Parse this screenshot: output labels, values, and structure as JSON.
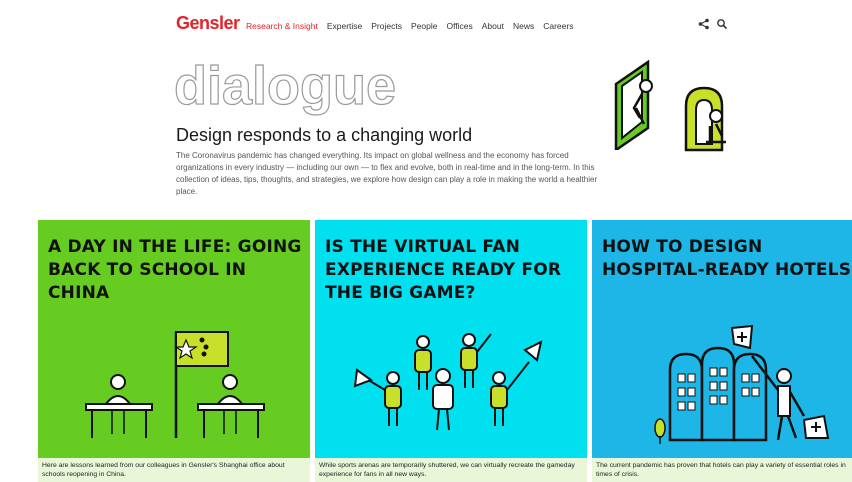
{
  "header": {
    "logo": "Gensler",
    "nav": [
      {
        "label": "Research & Insight",
        "active": true
      },
      {
        "label": "Expertise",
        "active": false
      },
      {
        "label": "Projects",
        "active": false
      },
      {
        "label": "People",
        "active": false
      },
      {
        "label": "Offices",
        "active": false
      },
      {
        "label": "About",
        "active": false
      },
      {
        "label": "News",
        "active": false
      },
      {
        "label": "Careers",
        "active": false
      }
    ],
    "icons": [
      "share-icon",
      "search-icon"
    ]
  },
  "hero": {
    "wordmark": "dialogue",
    "headline": "Design responds to a changing world",
    "intro": "The Coronavirus pandemic has changed everything. Its impact on global wellness and the economy has forced organizations in every industry — including our own — to flex and evolve, both in real-time and in the long-term. In this collection of ideas, tips, thoughts, and strategies, we explore how design can play a role in making the world a healthier place."
  },
  "cards": [
    {
      "title": "A DAY IN THE LIFE: GOING BACK TO SCHOOL IN CHINA",
      "caption": "Here are lessons learned from our colleagues in Gensler's Shanghai office about schools reopening in China.",
      "color": "#66cc22"
    },
    {
      "title": "IS THE VIRTUAL FAN EXPERIENCE READY FOR THE BIG GAME?",
      "caption": "While sports arenas are temporarily shuttered, we can virtually recreate the gameday experience for fans in all new ways.",
      "color": "#00e0ee"
    },
    {
      "title": "HOW TO DESIGN HOSPITAL-READY HOTELS",
      "caption": "The current pandemic has proven that hotels can play a variety of essential roles in times of crisis.",
      "color": "#1eb6e6"
    }
  ],
  "colors": {
    "brand": "#e0242a",
    "green": "#66cc22",
    "lime": "#c8e02a",
    "cyan": "#00e0ee",
    "blue": "#1eb6e6"
  }
}
